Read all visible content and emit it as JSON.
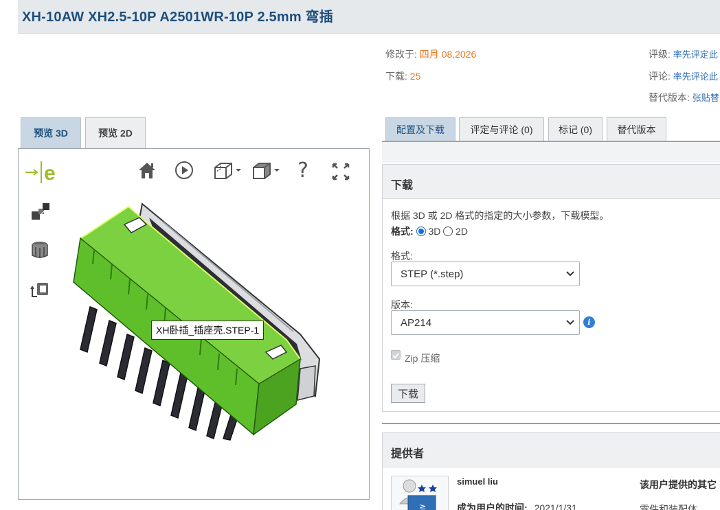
{
  "title": "XH-10AW XH2.5-10P A2501WR-10P 2.5mm 弯插",
  "meta": {
    "modified_label": "修改于:",
    "modified_value": "四月 08,2026",
    "downloads_label": "下载:",
    "downloads_value": "25",
    "rating_label": "评级:",
    "rating_link": "率先评定此",
    "comment_label": "评论:",
    "comment_link": "率先评论此",
    "alt_label": "替代版本:",
    "alt_link": "张贴替"
  },
  "preview_tabs": [
    "预览 3D",
    "预览 2D"
  ],
  "viewer": {
    "logo_text": "e",
    "tooltip": "XH卧插_插座壳.STEP-1",
    "help_glyph": "?"
  },
  "right_tabs": [
    "配置及下载",
    "评定与评论 (0)",
    "标记 (0)",
    "替代版本"
  ],
  "download": {
    "heading": "下载",
    "description": "根据 3D 或 2D 格式的指定的大小参数，下载模型。",
    "format_radio_label": "格式:",
    "radio_3d": "3D",
    "radio_2d": "2D",
    "format_label": "格式:",
    "format_value": "STEP (*.step)",
    "version_label": "版本:",
    "version_value": "AP214",
    "info_glyph": "i",
    "zip_label": "Zip 压缩",
    "download_button": "下载"
  },
  "provider": {
    "heading": "提供者",
    "name": "simuel liu",
    "member_since_label": "成为用户的时间:",
    "member_since_value": "2021/1/31",
    "other_title": "该用户提供的其它",
    "other_sub": "零件和装配体"
  },
  "colors": {
    "title": "#1d4f7c",
    "accent_orange": "#e87722",
    "link_blue": "#2b6cb0",
    "model_green": "#5fbf2a",
    "logo_green": "#9bbf2a"
  }
}
